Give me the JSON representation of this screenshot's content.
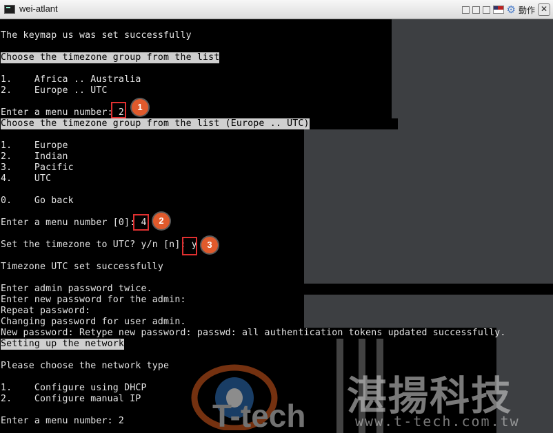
{
  "window": {
    "title": "wei-atlant",
    "menu_label": "動作"
  },
  "terminal": {
    "lines": [
      "The keymap us was set successfully",
      "",
      "Choose the timezone group from the list",
      "",
      "1.    Africa .. Australia",
      "2.    Europe .. UTC",
      "",
      "Enter a menu number: 2",
      "Choose the timezone group from the list (Europe .. UTC)",
      "",
      "1.    Europe",
      "2.    Indian",
      "3.    Pacific",
      "4.    UTC",
      "",
      "0.    Go back",
      "",
      "Enter a menu number [0]: 4",
      "",
      "Set the timezone to UTC? y/n [n]: y",
      "",
      "Timezone UTC set successfully",
      "",
      "Enter admin password twice.",
      "Enter new password for the admin:",
      "Repeat password:",
      "Changing password for user admin.",
      "New password: Retype new password: passwd: all authentication tokens updated successfully.",
      "Setting up the network",
      "",
      "Please choose the network type",
      "",
      "1.    Configure using DHCP",
      "2.    Configure manual IP",
      "",
      "Enter a menu number: 2"
    ]
  },
  "annotations": {
    "step1": "1",
    "step2": "2",
    "step3": "3"
  },
  "watermark": {
    "logo_text": "T-tech",
    "company_cn": "湛揚科技",
    "url": "www.t-tech.com.tw"
  },
  "colors": {
    "accent_badge": "#e05a2c",
    "highlight_box": "#e03030"
  }
}
